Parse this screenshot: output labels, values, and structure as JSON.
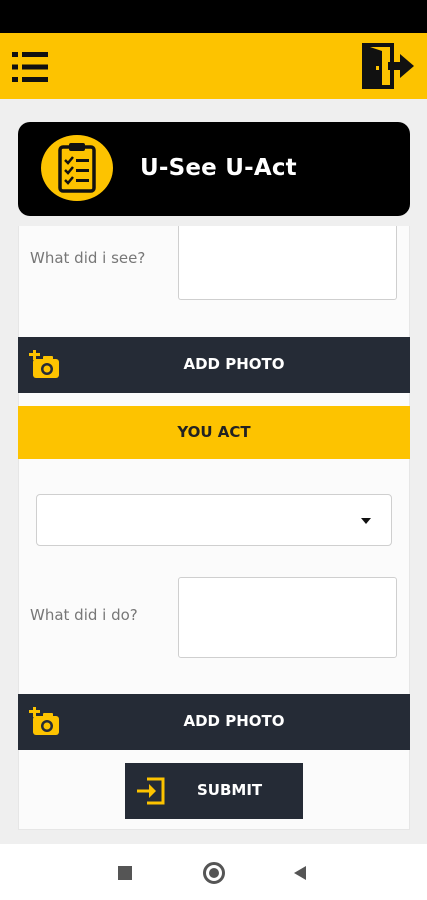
{
  "colors": {
    "accent": "#fdc300",
    "dark": "#252b36",
    "header_bg": "#000000"
  },
  "app_bar": {
    "menu_icon": "menu-list-icon",
    "logout_icon": "logout-door-icon"
  },
  "header": {
    "icon": "clipboard-checklist-icon",
    "title": "U-See U-Act"
  },
  "see_section": {
    "label": "What did i see?",
    "value": "",
    "add_photo_label": "ADD PHOTO",
    "add_photo_icon": "add-camera-icon"
  },
  "act_section": {
    "heading": "YOU ACT",
    "dropdown_value": "",
    "label": "What did i do?",
    "value": "",
    "add_photo_label": "ADD PHOTO",
    "add_photo_icon": "add-camera-icon"
  },
  "submit": {
    "label": "SUBMIT",
    "icon": "login-arrow-icon"
  }
}
